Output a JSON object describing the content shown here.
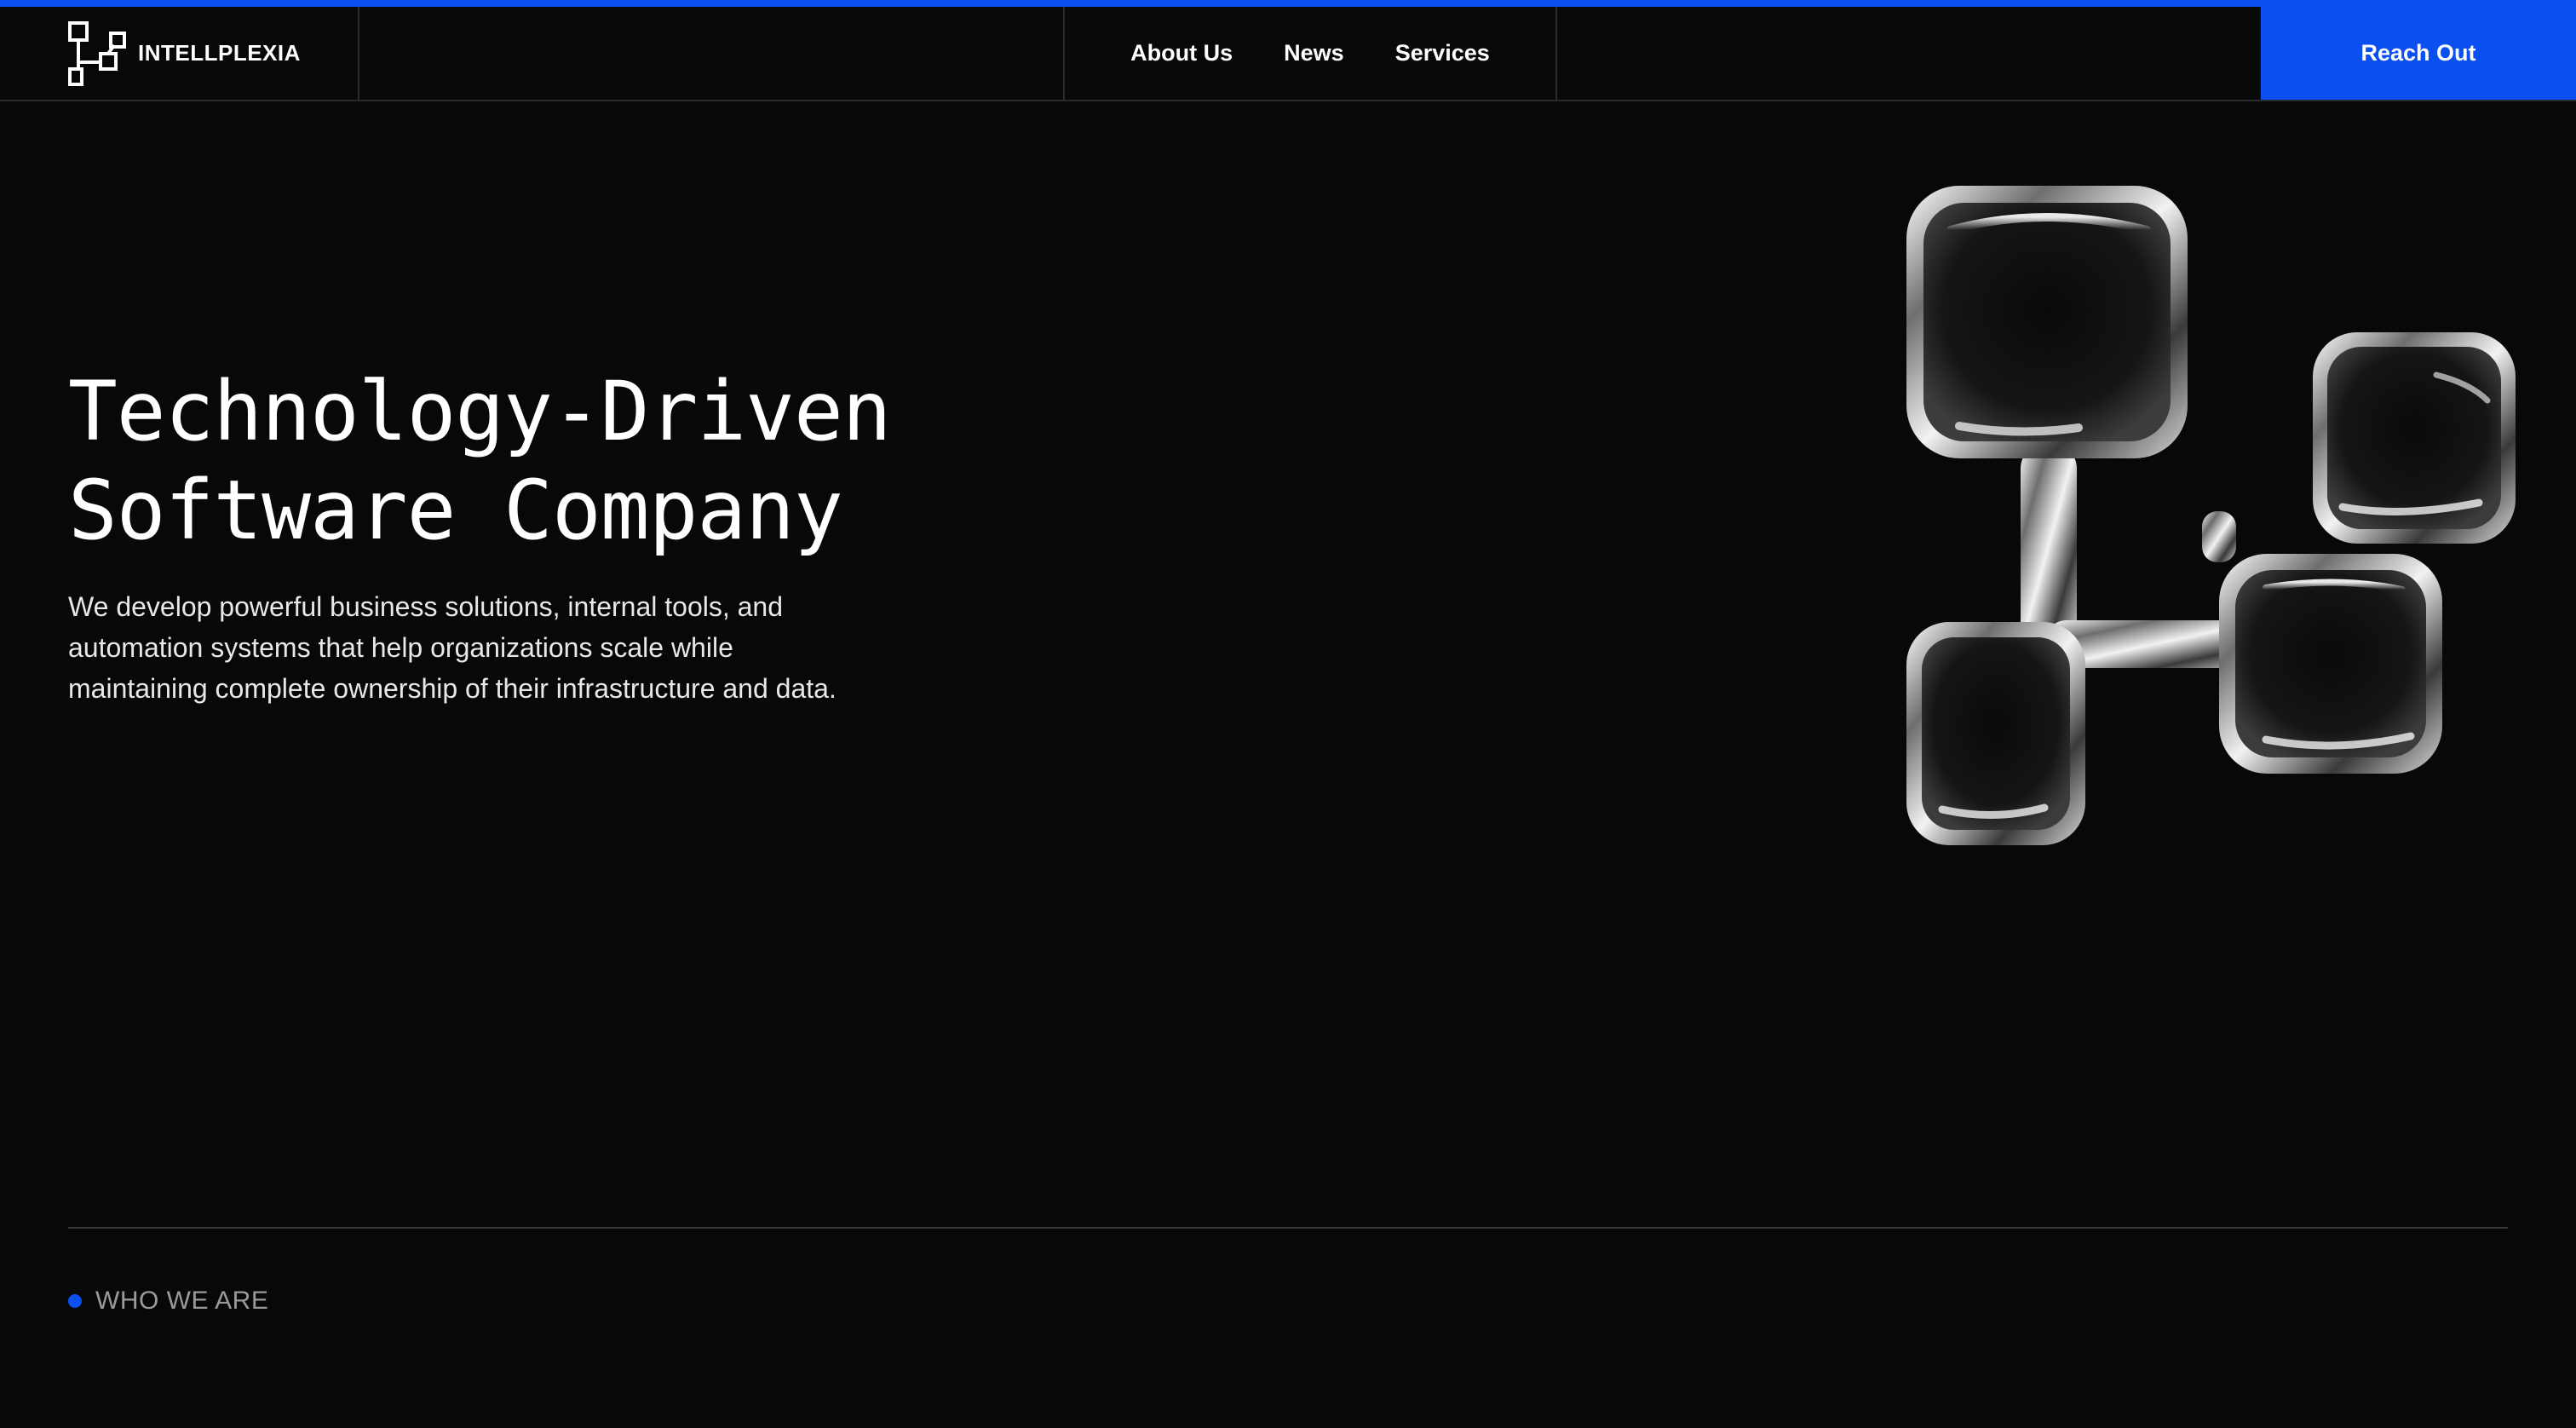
{
  "colors": {
    "accent": "#0a4ff0",
    "background": "#080808",
    "border": "#2a2a2a",
    "text": "#ffffff",
    "muted_text": "#9a9a9a"
  },
  "header": {
    "brand": {
      "icon": "circuit-squares-logo-icon",
      "name": "INTELLPLEXIA"
    },
    "nav": [
      {
        "label": "About Us"
      },
      {
        "label": "News"
      },
      {
        "label": "Services"
      }
    ],
    "cta_label": "Reach Out"
  },
  "hero": {
    "title_line1": "Technology-Driven",
    "title_line2": "Software Company",
    "description": "We develop powerful business solutions, internal tools, and automation systems that help organizations scale while maintaining complete ownership of their infrastructure and data.",
    "art_icon": "chrome-connected-squares-icon"
  },
  "section": {
    "label": "WHO WE ARE"
  }
}
